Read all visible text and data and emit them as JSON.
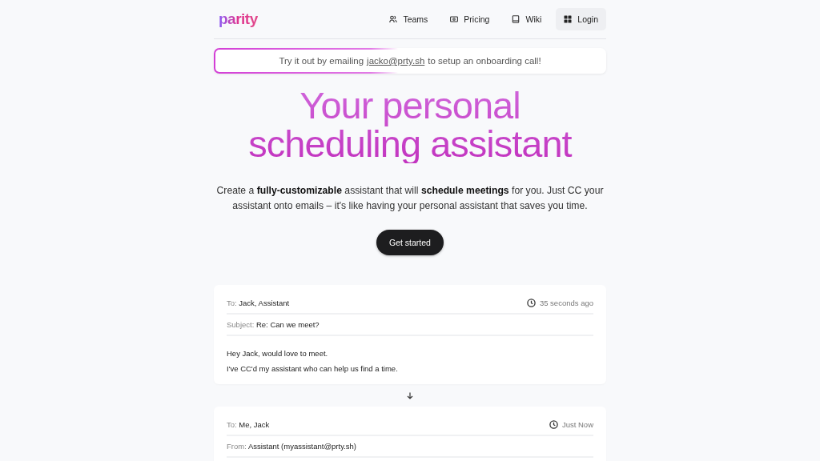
{
  "logo": "parity",
  "nav": [
    {
      "label": "Teams",
      "kind": "link"
    },
    {
      "label": "Pricing",
      "kind": "link"
    },
    {
      "label": "Wiki",
      "kind": "link"
    },
    {
      "label": "Login",
      "kind": "button"
    }
  ],
  "banner": {
    "before": "Try it out by emailing",
    "link": "jacko@prty.sh",
    "after": "to setup an onboarding call!"
  },
  "headline_lines": [
    "Your personal",
    "scheduling assistant"
  ],
  "intro": "Create a **fully-customizable** assistant that will **schedule meetings** for you. Just CC your assistant onto emails – it's like having your personal assistant that saves you time.",
  "cta": "Get started",
  "emails": [
    {
      "time": "35 seconds ago",
      "fields": [
        {
          "label": "To:",
          "value": "Jack, Assistant"
        },
        {
          "label": "Subject:",
          "value": "Re: Can we meet?"
        }
      ],
      "body": [
        "Hey Jack, would love to meet.",
        "I've CC'd my assistant who can help us find a time."
      ]
    },
    {
      "time": "Just Now",
      "fields": [
        {
          "label": "To:",
          "value": "Me, Jack"
        },
        {
          "label": "From:",
          "value": "Assistant (myassistant@prty.sh)"
        }
      ]
    }
  ]
}
